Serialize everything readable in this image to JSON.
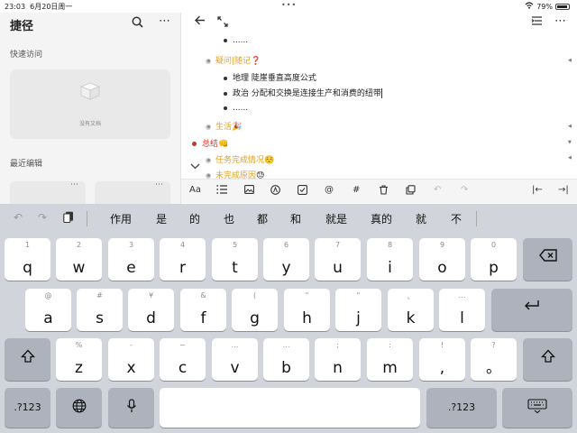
{
  "status_bar": {
    "time": "23:03",
    "date": "6月20日周一",
    "battery": "79%"
  },
  "sidebar": {
    "title": "捷径",
    "quick_access_label": "快速访问",
    "empty_text": "没有文档",
    "recent_label": "最近编辑"
  },
  "editor": {
    "lines": [
      {
        "text": "......"
      },
      {
        "text": "疑问|随记",
        "emoji": "❓"
      },
      {
        "text": "地理 陡崖垂直高度公式"
      },
      {
        "text": "政治 分配和交换是连接生产和消费的纽带"
      },
      {
        "text": "......"
      },
      {
        "text": "生活",
        "emoji": "🎉"
      },
      {
        "text": "总结",
        "emoji": "👊"
      },
      {
        "text": "任务完成情况",
        "emoji": "☺️"
      },
      {
        "text": "未完成原因",
        "emoji": "😓"
      }
    ]
  },
  "format_toolbar": {
    "text_style_label": "Aa"
  },
  "keyboard": {
    "candidates": [
      "作用",
      "是",
      "的",
      "也",
      "都",
      "和",
      "就是",
      "真的",
      "就",
      "不"
    ],
    "row1": [
      {
        "main": "q",
        "hint": "1"
      },
      {
        "main": "w",
        "hint": "2"
      },
      {
        "main": "e",
        "hint": "3"
      },
      {
        "main": "r",
        "hint": "4"
      },
      {
        "main": "t",
        "hint": "5"
      },
      {
        "main": "y",
        "hint": "6"
      },
      {
        "main": "u",
        "hint": "7"
      },
      {
        "main": "i",
        "hint": "8"
      },
      {
        "main": "o",
        "hint": "9"
      },
      {
        "main": "p",
        "hint": "0"
      }
    ],
    "row2": [
      {
        "main": "a",
        "hint": "@"
      },
      {
        "main": "s",
        "hint": "#"
      },
      {
        "main": "d",
        "hint": "¥"
      },
      {
        "main": "f",
        "hint": "&"
      },
      {
        "main": "g",
        "hint": "("
      },
      {
        "main": "h",
        "hint": "\""
      },
      {
        "main": "j",
        "hint": "\""
      },
      {
        "main": "k",
        "hint": "、"
      },
      {
        "main": "l",
        "hint": "…"
      }
    ],
    "row3": [
      {
        "main": "z",
        "hint": "%"
      },
      {
        "main": "x",
        "hint": "-"
      },
      {
        "main": "c",
        "hint": "~"
      },
      {
        "main": "v",
        "hint": "…"
      },
      {
        "main": "b",
        "hint": "…"
      },
      {
        "main": "n",
        "hint": ";"
      },
      {
        "main": "m",
        "hint": ":"
      }
    ],
    "punct_comma": {
      "main": ",",
      "hint": "!"
    },
    "punct_period": {
      "main": "。",
      "hint": "?"
    },
    "numbers_label": ".?123"
  }
}
